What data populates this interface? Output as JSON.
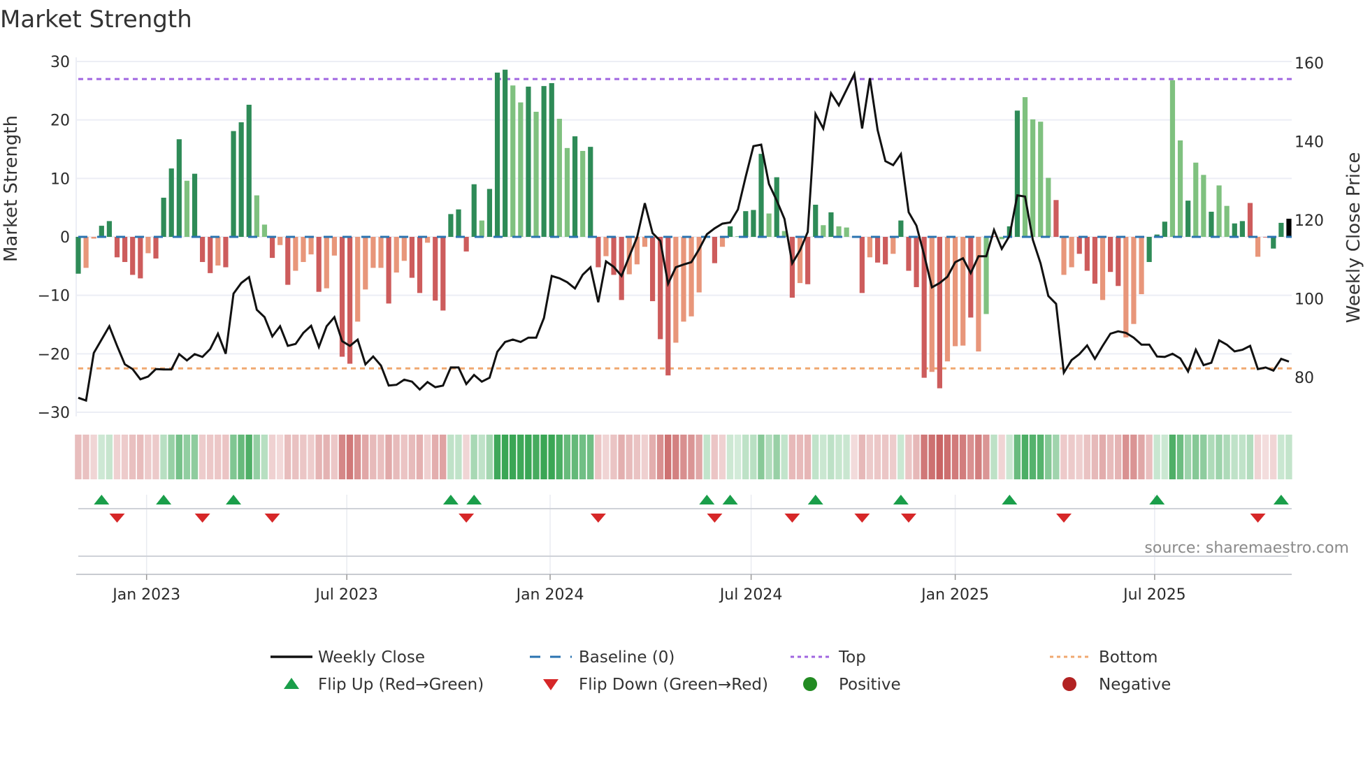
{
  "chart_data": {
    "type": "bar",
    "title": "Market Strength",
    "ylabel": "Market Strength",
    "y2label": "Weekly Close Price",
    "ylim": [
      -30,
      30
    ],
    "y2lim": [
      71,
      160.4
    ],
    "yticks": [
      30,
      20,
      10,
      0,
      -10,
      -20,
      -30
    ],
    "ytick_labels": [
      "30",
      "20",
      "10",
      "0",
      "−10",
      "−20",
      "−30"
    ],
    "y2ticks": [
      160,
      140,
      120,
      100,
      80
    ],
    "y2tick_labels": [
      "160",
      "140",
      "120",
      "100",
      "80"
    ],
    "x_unit": "week index (weekly bars, Nov 2022 – Dec 2025)",
    "xticks": [
      {
        "week": 8.8,
        "label": "Jan 2023"
      },
      {
        "week": 34.6,
        "label": "Jul 2023"
      },
      {
        "week": 60.8,
        "label": "Jan 2024"
      },
      {
        "week": 86.7,
        "label": "Jul 2024"
      },
      {
        "week": 113.0,
        "label": "Jan 2025"
      },
      {
        "week": 138.7,
        "label": "Jul 2025"
      }
    ],
    "top_level": 27,
    "bottom_level": -22.5,
    "baseline": 0,
    "strength": [
      -6.3,
      -5.3,
      -0.3,
      1.9,
      2.7,
      -3.5,
      -4.3,
      -6.5,
      -7.1,
      -2.8,
      -3.7,
      6.7,
      11.7,
      16.7,
      9.6,
      10.8,
      -4.3,
      -6.2,
      -4.9,
      -5.2,
      18.1,
      19.6,
      22.6,
      7.1,
      2.1,
      -3.6,
      -1.4,
      -8.2,
      -5.8,
      -4.3,
      -3.0,
      -9.4,
      -8.8,
      -3.2,
      -20.5,
      -21.7,
      -14.5,
      -9.0,
      -5.3,
      -5.3,
      -11.4,
      -6.1,
      -4.1,
      -7.0,
      -9.6,
      -1.0,
      -10.9,
      -12.6,
      3.9,
      4.7,
      -2.5,
      9.0,
      2.8,
      8.2,
      28.1,
      28.6,
      25.9,
      23.0,
      25.7,
      21.4,
      25.8,
      26.3,
      20.2,
      15.2,
      17.2,
      14.7,
      15.4,
      -5.2,
      -3.3,
      -6.5,
      -10.8,
      -6.4,
      -4.7,
      -1.7,
      -11.0,
      -17.5,
      -23.7,
      -18.1,
      -14.5,
      -13.6,
      -9.5,
      0.2,
      -4.5,
      -1.7,
      1.8,
      0.1,
      4.4,
      4.6,
      14.2,
      4.0,
      10.2,
      1.0,
      -10.4,
      -7.9,
      -8.1,
      5.5,
      2.0,
      4.2,
      1.8,
      1.6,
      -0.1,
      -9.6,
      -3.5,
      -4.4,
      -4.7,
      -2.9,
      2.8,
      -5.8,
      -8.6,
      -24.1,
      -23.1,
      -25.9,
      -21.3,
      -18.7,
      -18.6,
      -13.8,
      -19.6,
      -13.2,
      0.1,
      -0.4,
      1.8,
      21.6,
      23.9,
      20.1,
      19.7,
      10.1,
      6.3,
      -6.5,
      -5.2,
      -2.9,
      -5.8,
      -8.0,
      -10.8,
      -6.0,
      -8.4,
      -17.2,
      -14.9,
      -9.8,
      -4.3,
      0.4,
      2.6,
      26.8,
      16.5,
      6.2,
      12.7,
      10.6,
      4.3,
      8.8,
      5.3,
      2.3,
      2.7,
      5.8,
      -3.4,
      -0.1,
      -2.0,
      2.4,
      3.1
    ],
    "bar_shade": "GrrGGRRRRrRGGGgGRRrRGGGggRrRrrrRrrRRrrrrRrrRRrRRGGRGgGGGggGgGGggGgGRrRRrrrRRRrrrrGRrGgGGGgGgRrRGgGggrRrRRrGRRRrRrrrRrgRgGGggggRrrRRRrRRrrrGGGggGggGggGGRrRGG",
    "weekly_close": [
      74.8,
      74.1,
      86.2,
      89.6,
      93.0,
      88,
      83.3,
      82.1,
      79.5,
      80.2,
      82.1,
      82.0,
      82.0,
      85.9,
      84.3,
      85.9,
      85.2,
      87.2,
      91.1,
      86.0,
      101.3,
      104,
      105.5,
      97.2,
      95.3,
      90.4,
      93.0,
      88,
      88.5,
      91.3,
      93.1,
      87.7,
      93.0,
      95.3,
      89.2,
      88.0,
      89.6,
      83.3,
      85.3,
      83.0,
      77.9,
      78.1,
      79.4,
      78.9,
      76.9,
      78.8,
      77.5,
      77.9,
      82.5,
      82.5,
      78.3,
      80.6,
      78.9,
      79.9,
      86.5,
      89,
      89.6,
      89,
      90.1,
      90.1,
      95.1,
      105.8,
      105.2,
      104.2,
      102.6,
      106.1,
      108,
      99.1,
      109.5,
      108.1,
      105.8,
      110.8,
      115.6,
      124.3,
      116.7,
      114.7,
      103.8,
      108,
      108.7,
      109.3,
      112.6,
      116.4,
      117.9,
      119.1,
      119.4,
      122.7,
      131,
      138.8,
      139.2,
      129.2,
      125,
      120.3,
      109,
      112.3,
      117,
      147,
      143.3,
      152.3,
      149.2,
      153.2,
      157.2,
      143.3,
      156.1,
      142.9,
      135,
      134,
      136.8,
      122,
      118.6,
      111.1,
      102.9,
      104,
      105.6,
      109.3,
      110.3,
      106.5,
      110.8,
      110.8,
      117.5,
      112.7,
      116,
      126.3,
      126,
      115,
      109,
      100.7,
      98.7,
      81.2,
      84.4,
      85.9,
      88.1,
      84.7,
      88,
      91.1,
      91.7,
      91.3,
      90.1,
      88.3,
      88.3,
      85.3,
      85.2,
      86,
      84.8,
      81.5,
      87,
      83.1,
      83.7,
      89.4,
      88.3,
      86.6,
      87,
      88,
      82.1,
      82.5,
      81.7,
      84.7,
      84
    ],
    "flip_up_weeks": [
      3,
      11,
      20,
      48,
      51,
      81,
      84,
      95,
      106,
      120,
      139,
      155
    ],
    "flip_down_weeks": [
      5,
      16,
      25,
      50,
      67,
      82,
      92,
      101,
      107,
      127,
      152
    ],
    "legend": [
      {
        "label": "Weekly Close",
        "kind": "line",
        "color": "#111111"
      },
      {
        "label": "Baseline (0)",
        "kind": "dash",
        "color": "#2a73b0"
      },
      {
        "label": "Top",
        "kind": "dots",
        "color": "#a066e0"
      },
      {
        "label": "Bottom",
        "kind": "dots",
        "color": "#f0a870"
      },
      {
        "label": "Flip Up (Red→Green)",
        "kind": "triangle-up",
        "color": "#1a9e4a"
      },
      {
        "label": "Flip Down (Green→Red)",
        "kind": "triangle-down",
        "color": "#d62728"
      },
      {
        "label": "Positive",
        "kind": "circle",
        "color": "#228b22"
      },
      {
        "label": "Negative",
        "kind": "circle",
        "color": "#b22222"
      }
    ],
    "legend_placement": "bottom",
    "colors": {
      "G": "#2e8b57",
      "g": "#7fc17f",
      "R": "#cd5c5c",
      "r": "#e8967a",
      "heat_pos": "#3aa655",
      "heat_neg": "#c96464",
      "grid": "#eceef5",
      "price": "#111111"
    }
  },
  "source": "source: sharemaestro.com"
}
